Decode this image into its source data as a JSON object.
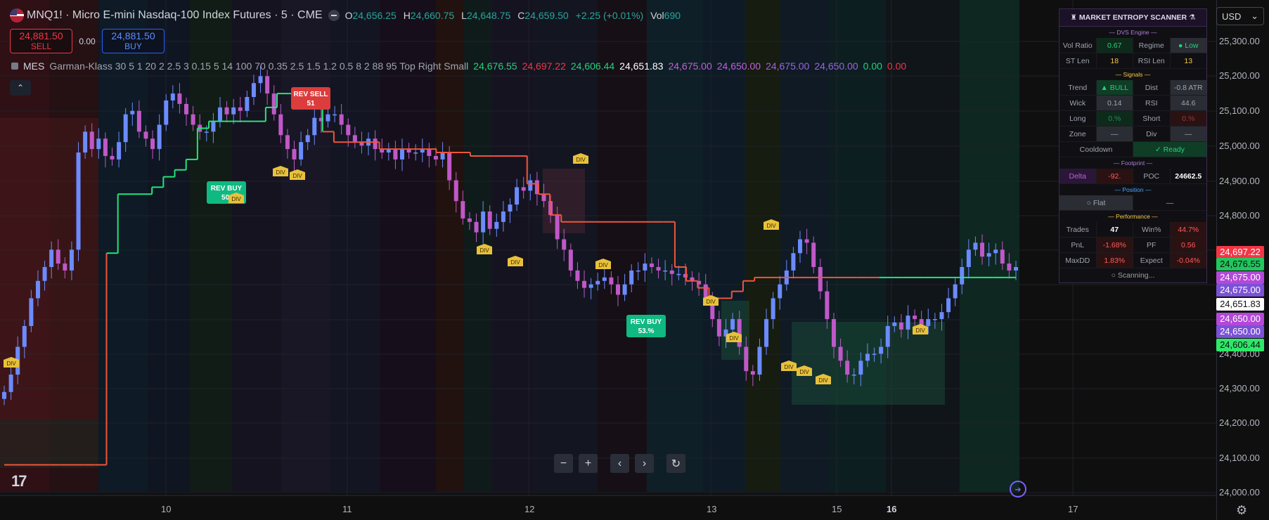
{
  "header": {
    "symbol_title": "MNQ1! · Micro E-mini Nasdaq-100 Index Futures · 5 · CME",
    "ohlc": [
      {
        "k": "O",
        "v": "24,656.25"
      },
      {
        "k": "H",
        "v": "24,660.75"
      },
      {
        "k": "L",
        "v": "24,648.75"
      },
      {
        "k": "C",
        "v": "24,659.50"
      },
      {
        "k": "",
        "v": "+2.25 (+0.01%)"
      },
      {
        "k": "Vol",
        "v": "690"
      }
    ]
  },
  "trade": {
    "sell_price": "24,881.50",
    "sell_label": "SELL",
    "spread": "0.00",
    "buy_price": "24,881.50",
    "buy_label": "BUY"
  },
  "indicator": {
    "name": "MES",
    "params": "Garman-Klass 30 5 1 20 2 2.5 3 0.15 5 14 100 70 0.35 2.5 1.5 1.2 0.5 8 2 88 95 Top Right Small",
    "values": [
      {
        "text": "24,676.55",
        "color": "#26d07c"
      },
      {
        "text": "24,697.22",
        "color": "#f23645"
      },
      {
        "text": "24,606.44",
        "color": "#26d07c"
      },
      {
        "text": "24,651.83",
        "color": "#ffffff"
      },
      {
        "text": "24,675.00",
        "color": "#c060d8"
      },
      {
        "text": "24,650.00",
        "color": "#c060d8"
      },
      {
        "text": "24,675.00",
        "color": "#9966dd"
      },
      {
        "text": "24,650.00",
        "color": "#9966dd"
      },
      {
        "text": "0.00",
        "color": "#26d07c"
      },
      {
        "text": "0.00",
        "color": "#f23645"
      }
    ],
    "collapse_icon": "chevron-up-icon"
  },
  "price_scale": {
    "currency": "USD",
    "ticks": [
      "25,300.00",
      "25,200.00",
      "25,100.00",
      "25,000.00",
      "24,900.00",
      "24,800.00",
      "24,700.00",
      "24,600.00",
      "24,500.00",
      "24,400.00",
      "24,300.00",
      "24,200.00",
      "24,100.00",
      "24,000.00"
    ],
    "labels": [
      {
        "text": "24,697.22",
        "bg": "#f23645",
        "fg": "#ffffff"
      },
      {
        "text": "24,676.55",
        "bg": "#22c55e",
        "fg": "#0f0f0f"
      },
      {
        "text": "24,675.00",
        "bg": "#b348d8",
        "fg": "#ffffff"
      },
      {
        "text": "24,675.00",
        "bg": "#7b52d6",
        "fg": "#ffffff"
      },
      {
        "text": "24,651.83",
        "bg": "#ffffff",
        "fg": "#0f0f0f"
      },
      {
        "text": "24,650.00",
        "bg": "#b348d8",
        "fg": "#ffffff"
      },
      {
        "text": "24,650.00",
        "bg": "#7b52d6",
        "fg": "#ffffff"
      },
      {
        "text": "24,606.44",
        "bg": "#2ee86a",
        "fg": "#0f0f0f"
      }
    ]
  },
  "time_axis": {
    "ticks": [
      {
        "text": "10",
        "bold": false
      },
      {
        "text": "11",
        "bold": false
      },
      {
        "text": "12",
        "bold": false
      },
      {
        "text": "13",
        "bold": false
      },
      {
        "text": "15",
        "bold": false
      },
      {
        "text": "16",
        "bold": true
      },
      {
        "text": "17",
        "bold": false
      }
    ]
  },
  "nav": {
    "zoom_out": "−",
    "zoom_in": "+",
    "scroll_left": "‹",
    "scroll_right": "›",
    "reset": "↻"
  },
  "logo": "17",
  "chart_data": {
    "type": "candlestick",
    "symbol": "MNQ1!",
    "interval": "5",
    "y_range": [
      24000,
      25340
    ],
    "closes": [
      24290,
      24340,
      24420,
      24480,
      24560,
      24610,
      24650,
      24700,
      24660,
      24640,
      24700,
      24980,
      25040,
      24990,
      25020,
      24970,
      24960,
      25010,
      25090,
      25100,
      25040,
      25020,
      24990,
      25060,
      25130,
      25150,
      25120,
      25090,
      25060,
      25040,
      25040,
      25070,
      25110,
      25090,
      25110,
      25100,
      25140,
      25180,
      25200,
      25150,
      25090,
      25030,
      24990,
      24960,
      25010,
      25030,
      25080,
      25070,
      25090,
      25090,
      25060,
      25030,
      25010,
      25000,
      25020,
      24990,
      24980,
      24990,
      24960,
      24990,
      24980,
      24980,
      24990,
      24970,
      24960,
      24980,
      24900,
      24840,
      24790,
      24780,
      24750,
      24810,
      24760,
      24780,
      24810,
      24830,
      24880,
      24870,
      24900,
      24860,
      24840,
      24800,
      24730,
      24700,
      24640,
      24610,
      24590,
      24600,
      24610,
      24620,
      24600,
      24570,
      24600,
      24640,
      24640,
      24660,
      24650,
      24640,
      24640,
      24630,
      24630,
      24620,
      24610,
      24600,
      24560,
      24500,
      24450,
      24470,
      24500,
      24420,
      24350,
      24340,
      24420,
      24500,
      24560,
      24600,
      24640,
      24690,
      24730,
      24720,
      24650,
      24580,
      24500,
      24420,
      24380,
      24340,
      24340,
      24380,
      24400,
      24400,
      24420,
      24480,
      24490,
      24470,
      24510,
      24500,
      24480,
      24500,
      24500,
      24520,
      24560,
      24600,
      24650,
      24700,
      24720,
      24680,
      24690,
      24700,
      24660,
      24640,
      24650
    ],
    "supertrend": [
      24080,
      24080,
      24080,
      24080,
      24080,
      24080,
      24080,
      24080,
      24080,
      24690,
      24860,
      24860,
      24860,
      24880,
      24910,
      24930,
      24960,
      25050,
      25070,
      25070,
      25070,
      25070,
      25070,
      25110,
      25150,
      25150,
      25150,
      25150,
      25040,
      25010,
      25010,
      25010,
      25010,
      24990,
      24990,
      24990,
      24990,
      24990,
      24980,
      24980,
      24980,
      24970,
      24970,
      24970,
      24970,
      24970,
      24890,
      24860,
      24800,
      24780,
      24780,
      24780,
      24780,
      24780,
      24780,
      24780,
      24780,
      24780,
      24780,
      24650,
      24610,
      24590,
      24560,
      24560,
      24580,
      24610,
      24620,
      24620,
      24620,
      24620,
      24620,
      24620,
      24620,
      24620,
      24620,
      24620,
      24620,
      24620,
      24620,
      24620,
      24620,
      24620,
      24620,
      24620,
      24620,
      24620,
      24620,
      24620,
      24620,
      24620
    ],
    "signals": [
      {
        "type": "REV BUY",
        "value": "50.",
        "color": "#10b981"
      },
      {
        "type": "REV SELL",
        "value": "51",
        "color": "#dc3c3c"
      },
      {
        "type": "REV BUY",
        "value": "53.%",
        "color": "#10b981"
      }
    ],
    "div_label": "DIV"
  },
  "scanner": {
    "title": "MARKET ENTROPY SCANNER",
    "dvs_header": "— DVS Engine —",
    "vol_ratio_label": "Vol Ratio",
    "vol_ratio": "0.67",
    "regime_label": "Regime",
    "regime": "Low",
    "st_len_label": "ST Len",
    "st_len": "18",
    "rsi_len_label": "RSI Len",
    "rsi_len": "13",
    "signals_header": "— Signals —",
    "trend_label": "Trend",
    "trend": "▲ BULL",
    "dist_label": "Dist",
    "dist": "-0.8 ATR",
    "wick_label": "Wick",
    "wick": "0.14",
    "rsi_label": "RSI",
    "rsi": "44.6",
    "long_label": "Long",
    "long": "0.%",
    "short_label": "Short",
    "short": "0.%",
    "zone_label": "Zone",
    "zone": "—",
    "div_label": "Div",
    "div": "—",
    "cooldown_label": "Cooldown",
    "cooldown": "✓ Ready",
    "footprint_header": "— Footprint —",
    "delta_label": "Delta",
    "delta": "-92.",
    "poc_label": "POC",
    "poc": "24662.5",
    "position_header": "— Position —",
    "position": "○ Flat",
    "position_val": "—",
    "performance_header": "— Performance —",
    "trades_label": "Trades",
    "trades": "47",
    "winpct_label": "Win%",
    "winpct": "44.7%",
    "pnl_label": "PnL",
    "pnl": "-1.68%",
    "pf_label": "PF",
    "pf": "0.56",
    "maxdd_label": "MaxDD",
    "maxdd": "1.83%",
    "expect_label": "Expect",
    "expect": "-0.04%",
    "footer": "○ Scanning..."
  }
}
